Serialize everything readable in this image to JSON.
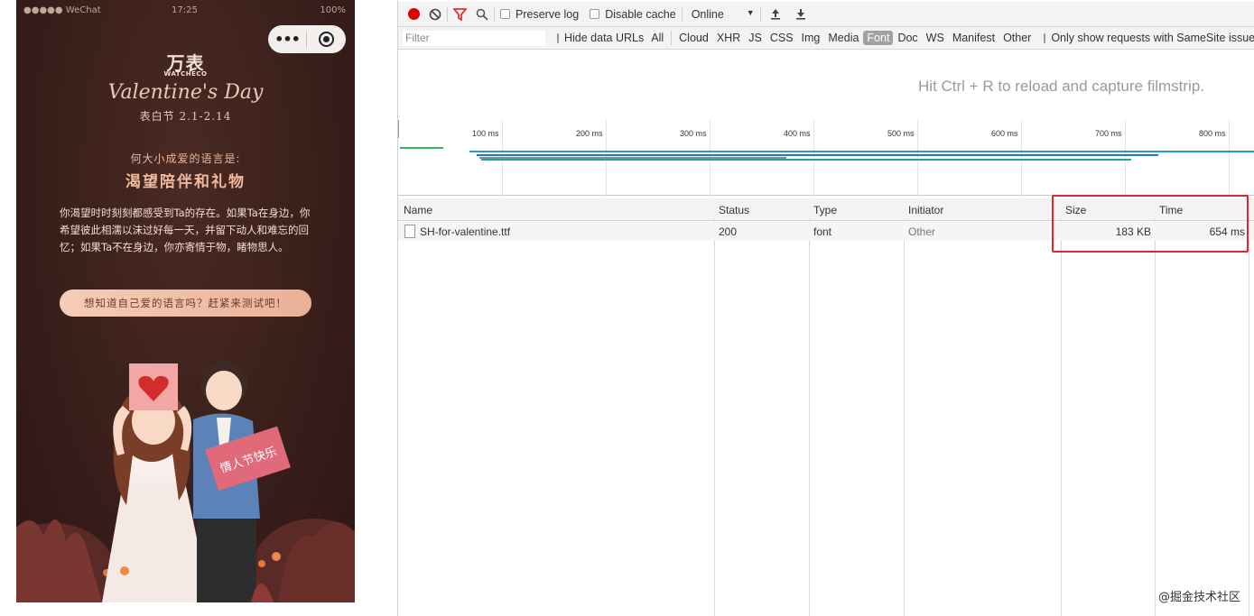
{
  "phone": {
    "status": {
      "carrier": "●●●●● WeChat",
      "time": "17:25",
      "battery": "100%"
    },
    "capsule": {
      "more_icon": "more-dots-icon",
      "close_icon": "target-close-icon"
    },
    "brand_cn": "万表",
    "brand_en": "WATCHECO",
    "title": "Valentine's Day",
    "dates": "表白节 2.1-2.14",
    "question": "何大小成爱的语言是:",
    "answer": "渴望陪伴和礼物",
    "description": "你渴望时时刻刻都感受到Ta的存在。如果Ta在身边，你希望彼此相濡以沫过好每一天，并留下动人和难忘的回忆；如果Ta不在身边，你亦寄情于物，睹物思人。",
    "cta": "想知道自己爱的语言吗？赶紧来测试吧！",
    "sign_text": "情人节快乐"
  },
  "devtools": {
    "toolbar": {
      "preserve_log": "Preserve log",
      "disable_cache": "Disable cache",
      "throttle": "Online",
      "throttle_arrow": "▼"
    },
    "filter": {
      "placeholder": "Filter",
      "hide_data_urls": "Hide data URLs",
      "types": [
        "All",
        "Cloud",
        "XHR",
        "JS",
        "CSS",
        "Img",
        "Media",
        "Font",
        "Doc",
        "WS",
        "Manifest",
        "Other"
      ],
      "active_type": "Font",
      "samesite": "Only show requests with SameSite issues"
    },
    "filmstrip_message": "Hit Ctrl + R to reload and capture filmstrip.",
    "timeline": {
      "ticks": [
        "100 ms",
        "200 ms",
        "300 ms",
        "400 ms",
        "500 ms",
        "600 ms",
        "700 ms",
        "800 ms"
      ]
    },
    "table": {
      "columns": [
        "Name",
        "Status",
        "Type",
        "Initiator",
        "Size",
        "Time"
      ],
      "rows": [
        {
          "name": "SH-for-valentine.ttf",
          "status": "200",
          "type": "font",
          "initiator": "Other",
          "size": "183 KB",
          "time": "654 ms"
        }
      ]
    },
    "colors": {
      "record": "#e00000",
      "filter_icon": "#e0332d",
      "highlight": "#e8232a",
      "active_type_bg": "#a2a2a2"
    }
  },
  "watermark": "@掘金技术社区"
}
